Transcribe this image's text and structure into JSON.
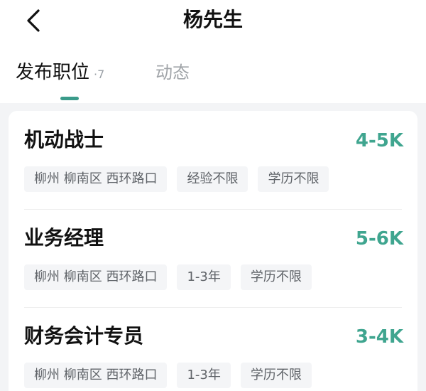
{
  "header": {
    "title": "杨先生"
  },
  "tabs": {
    "active_label": "发布职位",
    "active_count": "·7",
    "other_label": "动态"
  },
  "jobs": [
    {
      "title": "机动战士",
      "salary": "4-5K",
      "tags": [
        "柳州 柳南区 西环路口",
        "经验不限",
        "学历不限"
      ]
    },
    {
      "title": "业务经理",
      "salary": "5-6K",
      "tags": [
        "柳州 柳南区 西环路口",
        "1-3年",
        "学历不限"
      ]
    },
    {
      "title": "财务会计专员",
      "salary": "3-4K",
      "tags": [
        "柳州 柳南区 西环路口",
        "1-3年",
        "学历不限"
      ]
    }
  ],
  "colors": {
    "accent": "#3fa58f",
    "tab_indicator": "#3a9b8a",
    "page_background": "#f3f4f6",
    "tag_background": "#f4f5f7"
  },
  "icons": {
    "back": "chevron-left-icon"
  }
}
